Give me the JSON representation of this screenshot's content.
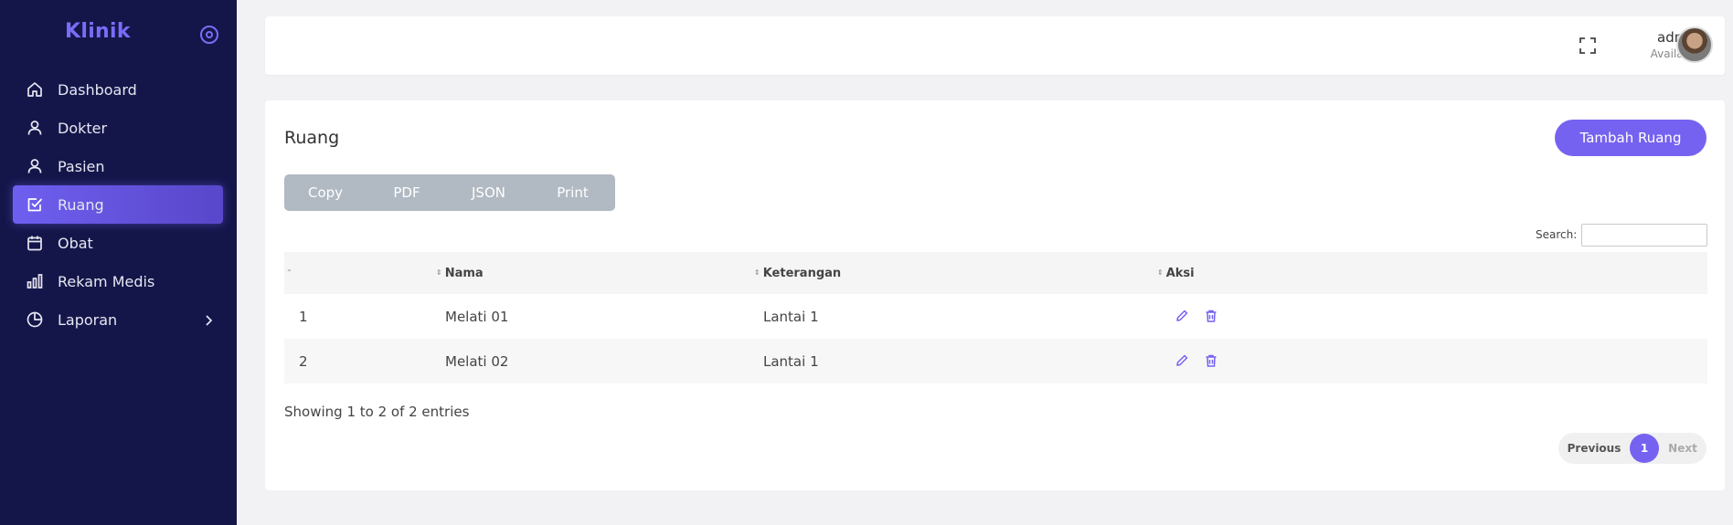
{
  "app": {
    "brand": "Klinik"
  },
  "sidebar": {
    "items": [
      {
        "label": "Dashboard",
        "icon": "home-icon"
      },
      {
        "label": "Dokter",
        "icon": "user-icon"
      },
      {
        "label": "Pasien",
        "icon": "user-icon"
      },
      {
        "label": "Ruang",
        "icon": "checkbox-icon",
        "active": true
      },
      {
        "label": "Obat",
        "icon": "calendar-icon"
      },
      {
        "label": "Rekam Medis",
        "icon": "bar-chart-icon"
      },
      {
        "label": "Laporan",
        "icon": "pie-chart-icon",
        "has_submenu": true
      }
    ]
  },
  "header": {
    "user_name": "admin",
    "user_status": "Available"
  },
  "main": {
    "title": "Ruang",
    "add_button": "Tambah Ruang",
    "export_buttons": [
      "Copy",
      "PDF",
      "JSON",
      "Print"
    ],
    "search_label": "Search:",
    "search_value": "",
    "table": {
      "columns": [
        "",
        "Nama",
        "Keterangan",
        "Aksi"
      ],
      "rows": [
        {
          "no": "1",
          "nama": "Melati 01",
          "keterangan": "Lantai 1"
        },
        {
          "no": "2",
          "nama": "Melati 02",
          "keterangan": "Lantai 1"
        }
      ]
    },
    "info": "Showing 1 to 2 of 2 entries",
    "pagination": {
      "previous": "Previous",
      "current": "1",
      "next": "Next"
    }
  },
  "colors": {
    "sidebar_bg": "#14164a",
    "accent": "#7562f0",
    "export_btn_bg": "#b1b9c2",
    "page_bg": "#f2f2f4"
  }
}
